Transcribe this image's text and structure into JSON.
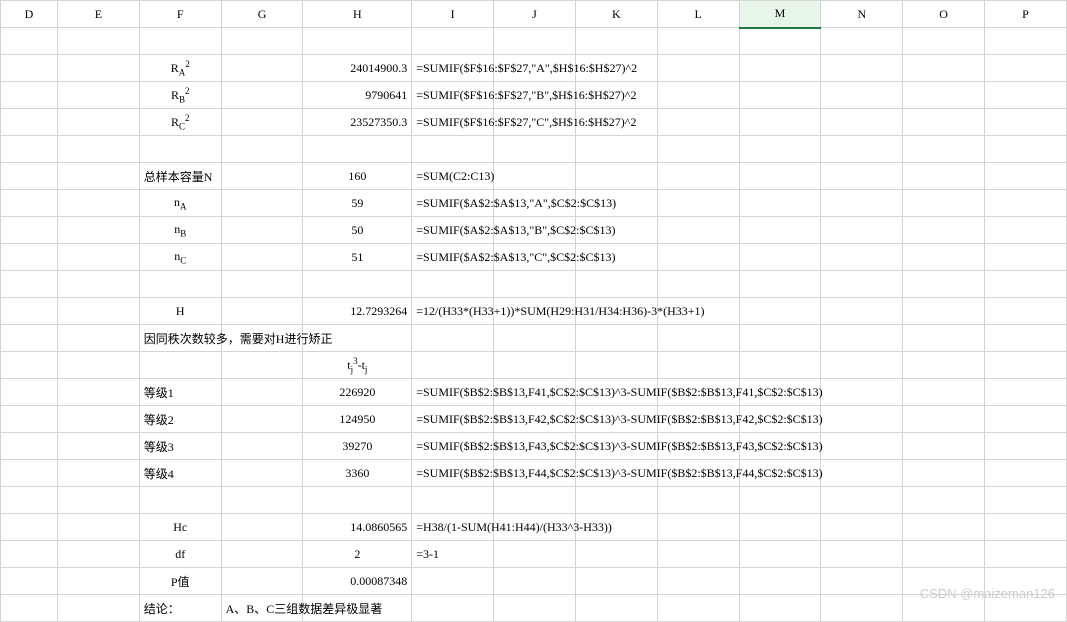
{
  "columns": [
    "D",
    "E",
    "F",
    "G",
    "H",
    "I",
    "J",
    "K",
    "L",
    "M",
    "N",
    "O",
    "P"
  ],
  "active_col": "M",
  "rows": {
    "r1": {
      "F_html": "R<span class='sub'>A</span><span class='sup'>2</span>",
      "H": "24014900.3",
      "I": "=SUMIF($F$16:$F$27,\"A\",$H$16:$H$27)^2"
    },
    "r2": {
      "F_html": "R<span class='sub'>B</span><span class='sup'>2</span>",
      "H": "9790641",
      "I": "=SUMIF($F$16:$F$27,\"B\",$H$16:$H$27)^2"
    },
    "r3": {
      "F_html": "R<span class='sub'>C</span><span class='sup'>2</span>",
      "H": "23527350.3",
      "I": "=SUMIF($F$16:$F$27,\"C\",$H$16:$H$27)^2"
    },
    "r5": {
      "F": "总样本容量N",
      "H": "160",
      "I": "=SUM(C2:C13)"
    },
    "r6": {
      "F_html": "n<span class='sub'>A</span>",
      "H": "59",
      "I": "=SUMIF($A$2:$A$13,\"A\",$C$2:$C$13)"
    },
    "r7": {
      "F_html": "n<span class='sub'>B</span>",
      "H": "50",
      "I": "=SUMIF($A$2:$A$13,\"B\",$C$2:$C$13)"
    },
    "r8": {
      "F_html": "n<span class='sub'>C</span>",
      "H": "51",
      "I": "=SUMIF($A$2:$A$13,\"C\",$C$2:$C$13)"
    },
    "r10": {
      "F": "H",
      "H": "12.7293264",
      "I": "=12/(H33*(H33+1))*SUM(H29:H31/H34:H36)-3*(H33+1)"
    },
    "r11": {
      "F": "因同秩次数较多，需要对H进行矫正"
    },
    "r12": {
      "H_html": "t<span class='sub'>j</span><span class='sup'>3</span>-t<span class='sub'>j</span>"
    },
    "r13": {
      "F": "等级1",
      "H": "226920",
      "I": "=SUMIF($B$2:$B$13,F41,$C$2:$C$13)^3-SUMIF($B$2:$B$13,F41,$C$2:$C$13)"
    },
    "r14": {
      "F": "等级2",
      "H": "124950",
      "I": "=SUMIF($B$2:$B$13,F42,$C$2:$C$13)^3-SUMIF($B$2:$B$13,F42,$C$2:$C$13)"
    },
    "r15": {
      "F": "等级3",
      "H": "39270",
      "I": "=SUMIF($B$2:$B$13,F43,$C$2:$C$13)^3-SUMIF($B$2:$B$13,F43,$C$2:$C$13)"
    },
    "r16": {
      "F": "等级4",
      "H": "3360",
      "I": "=SUMIF($B$2:$B$13,F44,$C$2:$C$13)^3-SUMIF($B$2:$B$13,F44,$C$2:$C$13)"
    },
    "r18": {
      "F": "Hc",
      "H": "14.0860565",
      "I": "=H38/(1-SUM(H41:H44)/(H33^3-H33))"
    },
    "r19": {
      "F": "df",
      "H": "2",
      "I": "=3-1"
    },
    "r20": {
      "F": "P值",
      "H": "0.00087348"
    },
    "r21": {
      "F": "结论：",
      "G": "A、B、C三组数据差异极显著"
    }
  },
  "watermark": "CSDN @maizeman126"
}
